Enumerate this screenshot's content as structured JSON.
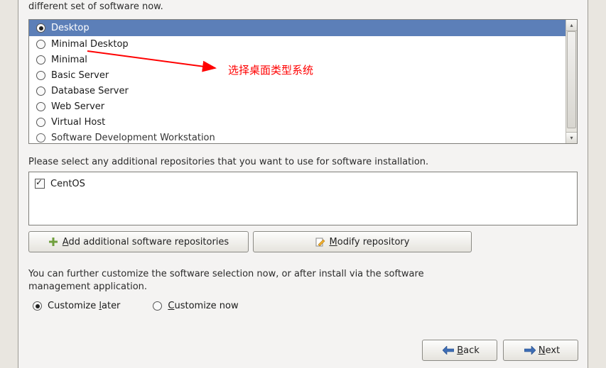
{
  "intro_text": "different set of software now.",
  "software_options": [
    {
      "label": "Desktop",
      "selected": true
    },
    {
      "label": "Minimal Desktop",
      "selected": false
    },
    {
      "label": "Minimal",
      "selected": false
    },
    {
      "label": "Basic Server",
      "selected": false
    },
    {
      "label": "Database Server",
      "selected": false
    },
    {
      "label": "Web Server",
      "selected": false
    },
    {
      "label": "Virtual Host",
      "selected": false
    },
    {
      "label": "Software Development Workstation",
      "selected": false
    }
  ],
  "repo_prompt": "Please select any additional repositories that you want to use for software installation.",
  "repos": [
    {
      "label": "CentOS",
      "checked": true
    }
  ],
  "buttons": {
    "add_repo_pre": "",
    "add_repo_mn": "A",
    "add_repo_post": "dd additional software repositories",
    "modify_repo_mn": "M",
    "modify_repo_post": "odify repository"
  },
  "customize_info_line1": "You can further customize the software selection now, or after install via the software",
  "customize_info_line2": "management application.",
  "customize_options": {
    "later_pre": "Customize ",
    "later_mn": "l",
    "later_post": "ater",
    "later_selected": true,
    "now_mn": "C",
    "now_post": "ustomize now",
    "now_selected": false
  },
  "nav": {
    "back_mn": "B",
    "back_post": "ack",
    "next_mn": "N",
    "next_post": "ext"
  },
  "annotation_text": "选择桌面类型系统"
}
